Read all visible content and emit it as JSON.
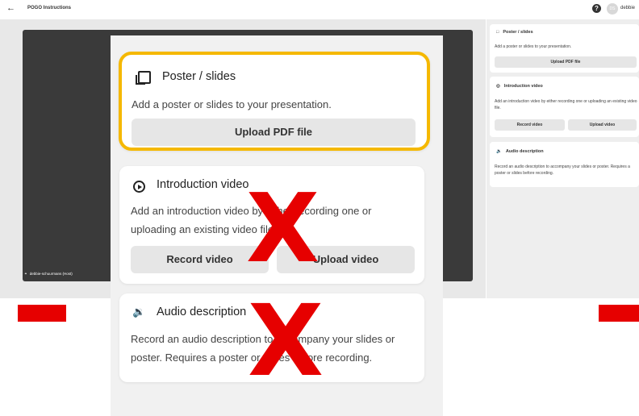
{
  "topbar": {
    "back_icon": "arrow-left-icon",
    "title": "POGO Instructions",
    "help_icon": "help-icon",
    "avatar_initials": "DS",
    "username": "debbie"
  },
  "stage": {
    "host_label": "debbie-schuurmans (Host)"
  },
  "sidepanel": {
    "poster": {
      "title": "Poster / slides",
      "description": "Add a poster or slides to your presentation.",
      "upload_label": "Upload PDF file"
    },
    "intro": {
      "title": "Introduction video",
      "description": "Add an introduction video by either recording one or uploading an existing video file.",
      "record_label": "Record video",
      "upload_label": "Upload video"
    },
    "audio": {
      "title": "Audio description",
      "description": "Record an audio description to accompany your slides or poster. Requires a poster or slides before recording."
    }
  },
  "overlay": {
    "poster": {
      "title": "Poster / slides",
      "description": "Add a poster or slides to your presentation.",
      "upload_label": "Upload PDF file"
    },
    "intro": {
      "title": "Introduction video",
      "description": "Add an introduction video by either recording one or uploading an existing video file.",
      "record_label": "Record video",
      "upload_label": "Upload video"
    },
    "audio": {
      "title": "Audio description",
      "description": "Record an audio description to accompany your slides or poster. Requires a poster or slides before recording."
    },
    "mark_text": "X"
  },
  "colors": {
    "highlight": "#f5b800",
    "mark": "#e60000"
  }
}
